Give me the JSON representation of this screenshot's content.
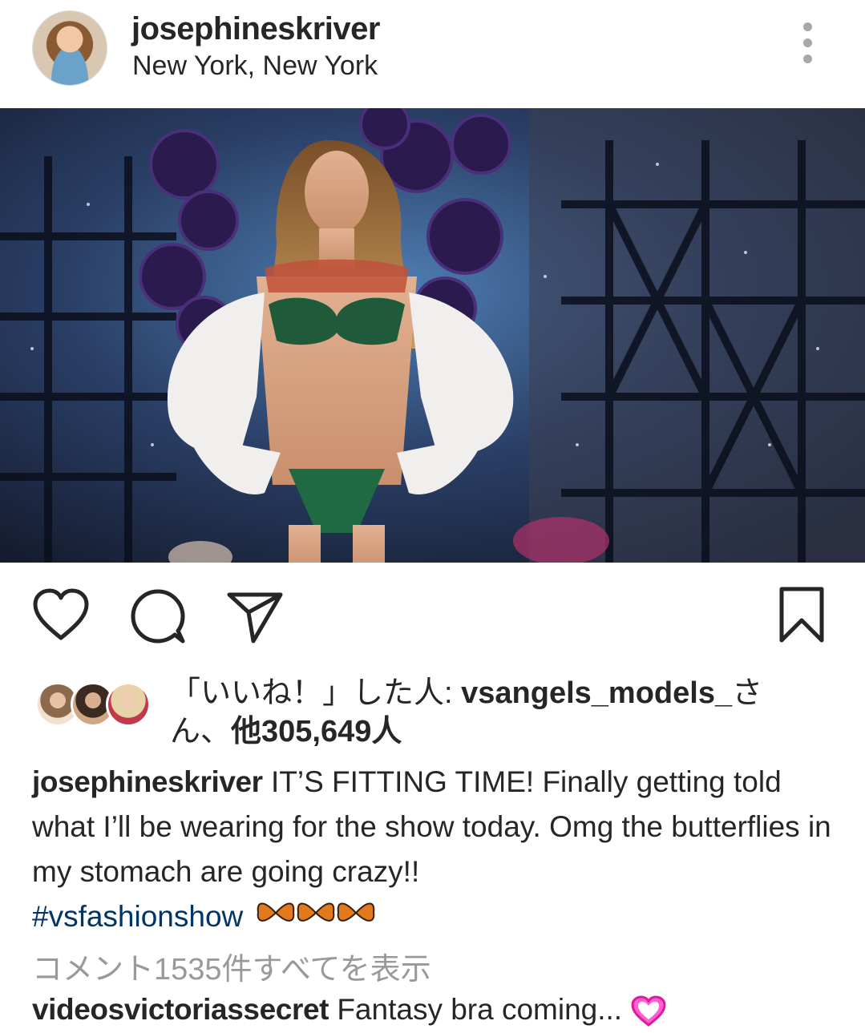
{
  "post": {
    "username": "josephineskriver",
    "location": "New York, New York"
  },
  "actions": {
    "like_icon": "heart-icon",
    "comment_icon": "comment-icon",
    "share_icon": "paper-plane-icon",
    "save_icon": "bookmark-icon"
  },
  "likes": {
    "prefix": "「いいね！」した人: ",
    "user": "vsangels_models_",
    "suffix": "さん、",
    "count": "他305,649人"
  },
  "caption": {
    "username": "josephineskriver",
    "text": "IT’S FITTING TIME! Finally getting told what I’ll be wearing for the show today. Omg the butterflies in my stomach are going crazy!!",
    "hashtag": "#vsfashionshow",
    "emoji": "butterfly-emoji"
  },
  "view_comments": "コメント1535件すべてを表示",
  "first_comment": {
    "username": "videosvictoriassecret",
    "text": "Fantasy bra coming...",
    "emoji": "heart-emoji"
  },
  "colors": {
    "text": "#262626",
    "muted": "#999999",
    "hashtag": "#003569",
    "heart_emoji": "#e0189b"
  }
}
